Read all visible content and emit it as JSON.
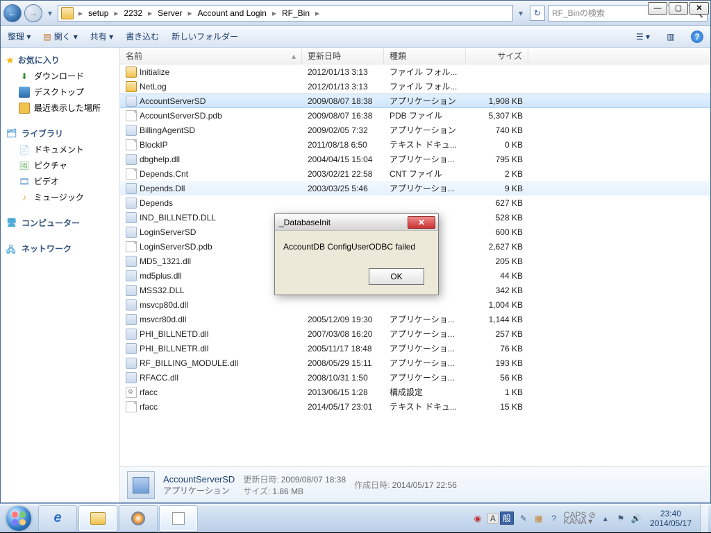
{
  "window": {
    "min": "—",
    "max": "▢",
    "close": "✕"
  },
  "breadcrumb": [
    "setup",
    "2232",
    "Server",
    "Account and Login",
    "RF_Bin"
  ],
  "search_placeholder": "RF_Binの検索",
  "cmdbar": {
    "organize": "整理 ▾",
    "open": "開く",
    "share": "共有 ▾",
    "burn": "書き込む",
    "newfolder": "新しいフォルダー"
  },
  "nav": {
    "fav": "お気に入り",
    "downloads": "ダウンロード",
    "desktop": "デスクトップ",
    "recent": "最近表示した場所",
    "libraries": "ライブラリ",
    "documents": "ドキュメント",
    "pictures": "ピクチャ",
    "videos": "ビデオ",
    "music": "ミュージック",
    "computer": "コンピューター",
    "network": "ネットワーク"
  },
  "columns": {
    "name": "名前",
    "date": "更新日時",
    "type": "種類",
    "size": "サイズ"
  },
  "files": [
    {
      "icon": "fold",
      "name": "Initialize",
      "date": "2012/01/13 3:13",
      "type": "ファイル フォル...",
      "size": ""
    },
    {
      "icon": "fold",
      "name": "NetLog",
      "date": "2012/01/13 3:13",
      "type": "ファイル フォル...",
      "size": ""
    },
    {
      "icon": "app",
      "name": "AccountServerSD",
      "date": "2009/08/07 18:38",
      "type": "アプリケーション",
      "size": "1,908 KB",
      "sel": true
    },
    {
      "icon": "file",
      "name": "AccountServerSD.pdb",
      "date": "2009/08/07 16:38",
      "type": "PDB ファイル",
      "size": "5,307 KB"
    },
    {
      "icon": "app",
      "name": "BillingAgentSD",
      "date": "2009/02/05 7:32",
      "type": "アプリケーション",
      "size": "740 KB"
    },
    {
      "icon": "file",
      "name": "BlockIP",
      "date": "2011/08/18 6:50",
      "type": "テキスト ドキュ...",
      "size": "0 KB"
    },
    {
      "icon": "dll",
      "name": "dbghelp.dll",
      "date": "2004/04/15 15:04",
      "type": "アプリケーショ...",
      "size": "795 KB"
    },
    {
      "icon": "file",
      "name": "Depends.Cnt",
      "date": "2003/02/21 22:58",
      "type": "CNT ファイル",
      "size": "2 KB"
    },
    {
      "icon": "dll",
      "name": "Depends.Dll",
      "date": "2003/03/25 5:46",
      "type": "アプリケーショ...",
      "size": "9 KB",
      "hov": true
    },
    {
      "icon": "app",
      "name": "Depends",
      "date": "",
      "type": "",
      "size": "627 KB"
    },
    {
      "icon": "dll",
      "name": "IND_BILLNETD.DLL",
      "date": "",
      "type": "",
      "size": "528 KB"
    },
    {
      "icon": "app",
      "name": "LoginServerSD",
      "date": "",
      "type": "",
      "size": "600 KB"
    },
    {
      "icon": "file",
      "name": "LoginServerSD.pdb",
      "date": "",
      "type": "",
      "size": "2,627 KB"
    },
    {
      "icon": "dll",
      "name": "MD5_1321.dll",
      "date": "",
      "type": "",
      "size": "205 KB"
    },
    {
      "icon": "dll",
      "name": "md5plus.dll",
      "date": "",
      "type": "",
      "size": "44 KB"
    },
    {
      "icon": "dll",
      "name": "MSS32.DLL",
      "date": "",
      "type": "",
      "size": "342 KB"
    },
    {
      "icon": "dll",
      "name": "msvcp80d.dll",
      "date": "",
      "type": "",
      "size": "1,004 KB"
    },
    {
      "icon": "dll",
      "name": "msvcr80d.dll",
      "date": "2005/12/09 19:30",
      "type": "アプリケーショ...",
      "size": "1,144 KB"
    },
    {
      "icon": "dll",
      "name": "PHI_BILLNETD.dll",
      "date": "2007/03/08 16:20",
      "type": "アプリケーショ...",
      "size": "257 KB"
    },
    {
      "icon": "dll",
      "name": "PHI_BILLNETR.dll",
      "date": "2005/11/17 18:48",
      "type": "アプリケーショ...",
      "size": "76 KB"
    },
    {
      "icon": "dll",
      "name": "RF_BILLING_MODULE.dll",
      "date": "2008/05/29 15:11",
      "type": "アプリケーショ...",
      "size": "193 KB"
    },
    {
      "icon": "dll",
      "name": "RFACC.dll",
      "date": "2008/10/31 1:50",
      "type": "アプリケーショ...",
      "size": "56 KB"
    },
    {
      "icon": "cfg",
      "name": "rfacc",
      "date": "2013/06/15 1:28",
      "type": "構成設定",
      "size": "1 KB"
    },
    {
      "icon": "file",
      "name": "rfacc",
      "date": "2014/05/17 23:01",
      "type": "テキスト ドキュ...",
      "size": "15 KB"
    }
  ],
  "details": {
    "name": "AccountServerSD",
    "type": "アプリケーション",
    "mod_label": "更新日時:",
    "mod": "2009/08/07 18:38",
    "size_label": "サイズ:",
    "size": "1.86 MB",
    "created_label": "作成日時:",
    "created": "2014/05/17 22:56"
  },
  "dialog": {
    "title": "_DatabaseInit",
    "message": "AccountDB ConfigUserODBC failed",
    "ok": "OK"
  },
  "ime": {
    "a": "A",
    "han": "般"
  },
  "caps": {
    "top": "CAPS ⊘",
    "bot": "KANA ▾"
  },
  "clock": {
    "time": "23:40",
    "date": "2014/05/17"
  }
}
